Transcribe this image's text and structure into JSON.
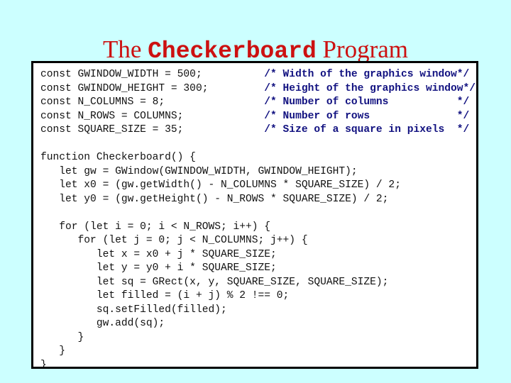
{
  "title": {
    "part1": "The ",
    "part2": "Checkerboard",
    "part3": " Program",
    "full": "The Checkerboard Program",
    "color": "#cc1111"
  },
  "colors": {
    "page_background": "#ccffff",
    "frame_background": "#ffffff",
    "frame_border": "#000000",
    "code_text": "#111111",
    "comment_text": "#111180",
    "title_text": "#cc1111"
  },
  "code": {
    "language": "javascript",
    "comment_column": 36,
    "close_comment_column": 67,
    "lines": [
      {
        "code": "const GWINDOW_WIDTH = 500;",
        "comment": "/* Width of the graphics window",
        "close": "*/"
      },
      {
        "code": "const GWINDOW_HEIGHT = 300;",
        "comment": "/* Height of the graphics window",
        "close": "*/"
      },
      {
        "code": "const N_COLUMNS = 8;",
        "comment": "/* Number of columns",
        "close": "*/"
      },
      {
        "code": "const N_ROWS = COLUMNS;",
        "comment": "/* Number of rows",
        "close": "*/"
      },
      {
        "code": "const SQUARE_SIZE = 35;",
        "comment": "/* Size of a square in pixels",
        "close": "*/"
      },
      {
        "code": "",
        "comment": "",
        "close": ""
      },
      {
        "code": "function Checkerboard() {",
        "comment": "",
        "close": ""
      },
      {
        "code": "   let gw = GWindow(GWINDOW_WIDTH, GWINDOW_HEIGHT);",
        "comment": "",
        "close": ""
      },
      {
        "code": "   let x0 = (gw.getWidth() - N_COLUMNS * SQUARE_SIZE) / 2;",
        "comment": "",
        "close": ""
      },
      {
        "code": "   let y0 = (gw.getHeight() - N_ROWS * SQUARE_SIZE) / 2;",
        "comment": "",
        "close": ""
      },
      {
        "code": "",
        "comment": "",
        "close": ""
      },
      {
        "code": "   for (let i = 0; i < N_ROWS; i++) {",
        "comment": "",
        "close": ""
      },
      {
        "code": "      for (let j = 0; j < N_COLUMNS; j++) {",
        "comment": "",
        "close": ""
      },
      {
        "code": "         let x = x0 + j * SQUARE_SIZE;",
        "comment": "",
        "close": ""
      },
      {
        "code": "         let y = y0 + i * SQUARE_SIZE;",
        "comment": "",
        "close": ""
      },
      {
        "code": "         let sq = GRect(x, y, SQUARE_SIZE, SQUARE_SIZE);",
        "comment": "",
        "close": ""
      },
      {
        "code": "         let filled = (i + j) % 2 !== 0;",
        "comment": "",
        "close": ""
      },
      {
        "code": "         sq.setFilled(filled);",
        "comment": "",
        "close": ""
      },
      {
        "code": "         gw.add(sq);",
        "comment": "",
        "close": ""
      },
      {
        "code": "      }",
        "comment": "",
        "close": ""
      },
      {
        "code": "   }",
        "comment": "",
        "close": ""
      },
      {
        "code": "}",
        "comment": "",
        "close": ""
      }
    ]
  }
}
